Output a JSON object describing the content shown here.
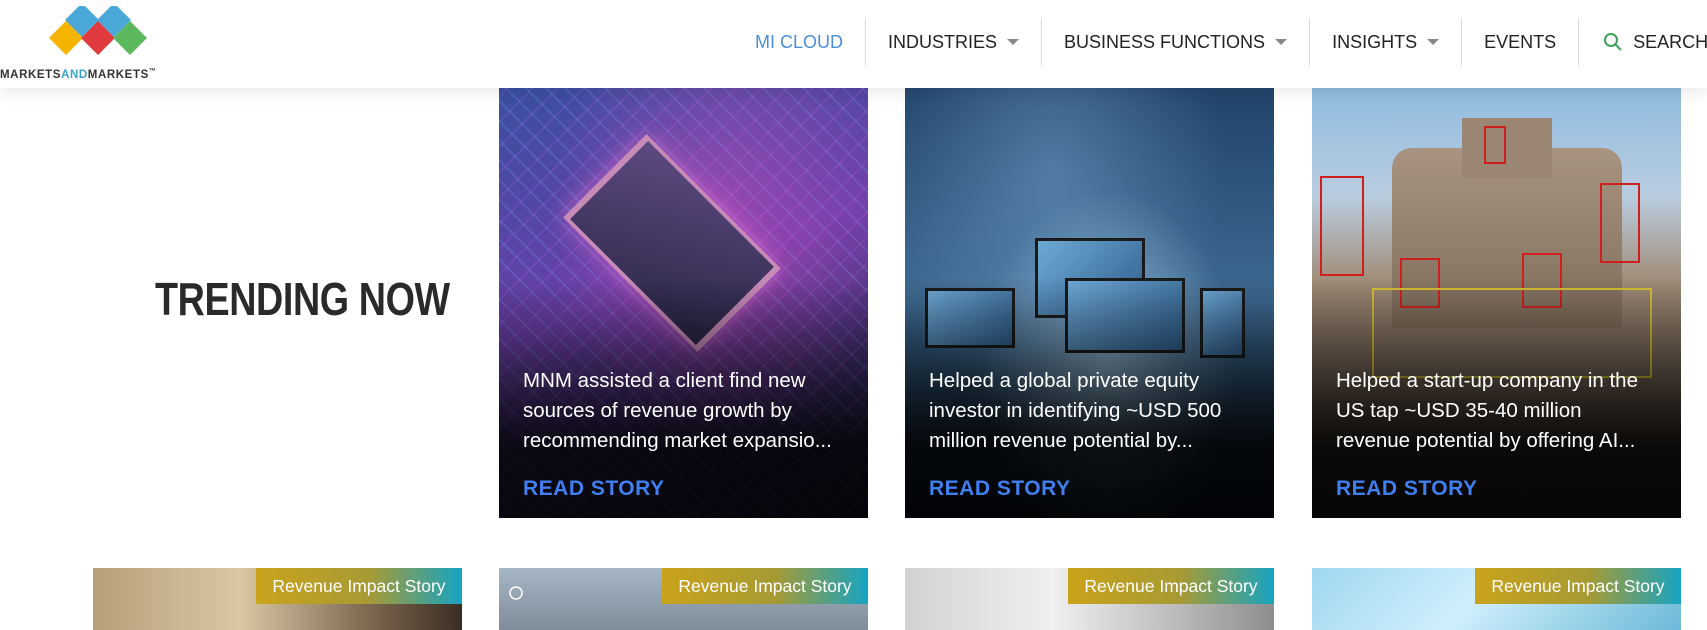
{
  "brand": {
    "logo_text_1": "MARKETS",
    "logo_text_2": "AND",
    "logo_text_3": "MARKETS",
    "logo_tm": "™",
    "colors": [
      "#f4b400",
      "#e03a3e",
      "#4aa8d8",
      "#5cb85c"
    ]
  },
  "nav": {
    "items": [
      {
        "label": "MI CLOUD",
        "has_caret": false,
        "active": true
      },
      {
        "label": "INDUSTRIES",
        "has_caret": true,
        "active": false
      },
      {
        "label": "BUSINESS FUNCTIONS",
        "has_caret": true,
        "active": false
      },
      {
        "label": "INSIGHTS",
        "has_caret": true,
        "active": false
      },
      {
        "label": "EVENTS",
        "has_caret": false,
        "active": false
      }
    ],
    "search_label": "SEARCH",
    "search_icon": "search-icon"
  },
  "trending": {
    "heading": "TRENDING NOW",
    "cards": [
      {
        "text": "MNM assisted a client find new sources of revenue growth by recommending market expansio...",
        "cta": "READ STORY"
      },
      {
        "text": "Helped a global private equity investor in identifying ~USD 500 million revenue potential by...",
        "cta": "READ STORY"
      },
      {
        "text": "Helped a start-up company in the US tap ~USD 35-40 million revenue potential by offering AI...",
        "cta": "READ STORY"
      }
    ]
  },
  "stories": {
    "badges": [
      "Revenue Impact Story",
      "Revenue Impact Story",
      "Revenue Impact Story",
      "Revenue Impact Story"
    ]
  },
  "colors": {
    "accent": "#4a8ed8",
    "cta": "#3f7ff0",
    "heading": "#2a2a2a"
  }
}
